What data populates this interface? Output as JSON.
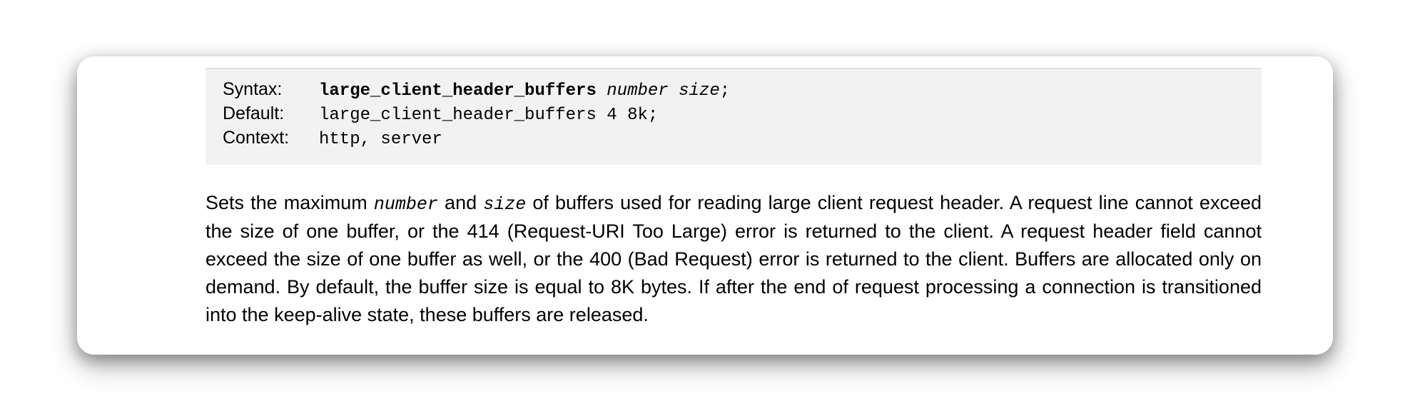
{
  "directive": {
    "syntax": {
      "label": "Syntax:",
      "name": "large_client_header_buffers",
      "param1": "number",
      "param2": "size",
      "terminator": ";"
    },
    "default": {
      "label": "Default:",
      "value": "large_client_header_buffers 4 8k;"
    },
    "context": {
      "label": "Context:",
      "value": "http, server"
    }
  },
  "description": {
    "part1": "Sets the maximum ",
    "code1": "number",
    "part2": " and ",
    "code2": "size",
    "part3": " of buffers used for reading large client request header. A request line cannot exceed the size of one buffer, or the 414 (Request-URI Too Large) error is returned to the client. A request header field cannot exceed the size of one buffer as well, or the 400 (Bad Request) error is returned to the client. Buffers are allocated only on demand. By default, the buffer size is equal to 8K bytes. If after the end of request processing a connection is transitioned into the keep-alive state, these buffers are released."
  }
}
